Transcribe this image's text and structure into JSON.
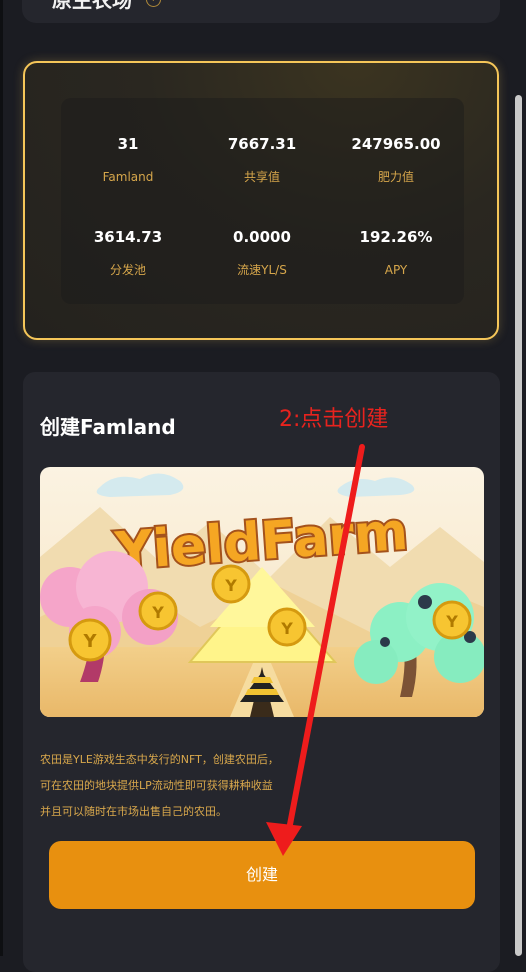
{
  "header": {
    "title": "原生农场",
    "help_icon": "question-circle-icon"
  },
  "stats": [
    {
      "value": "31",
      "label": "Famland"
    },
    {
      "value": "7667.31",
      "label": "共享值"
    },
    {
      "value": "247965.00",
      "label": "肥力值"
    },
    {
      "value": "3614.73",
      "label": "分发池"
    },
    {
      "value": "0.0000",
      "label": "流速YL/S"
    },
    {
      "value": "192.26%",
      "label": "APY"
    }
  ],
  "create": {
    "title": "创建Famland",
    "banner_text": "YieldFarm",
    "description": [
      "农田是YLE游戏生态中发行的NFT，创建农田后，",
      "可在农田的地块提供LP流动性即可获得耕种收益",
      "并且可以随时在市场出售自己的农田。"
    ],
    "button_label": "创建"
  },
  "annotation": {
    "text": "2:点击创建"
  },
  "colors": {
    "accent": "#e8900f",
    "gold_border": "#f5c659",
    "label_gold": "#d6a64b",
    "annotation_red": "#e8231e",
    "card_bg": "#25262d",
    "page_bg": "#1b1c22"
  }
}
